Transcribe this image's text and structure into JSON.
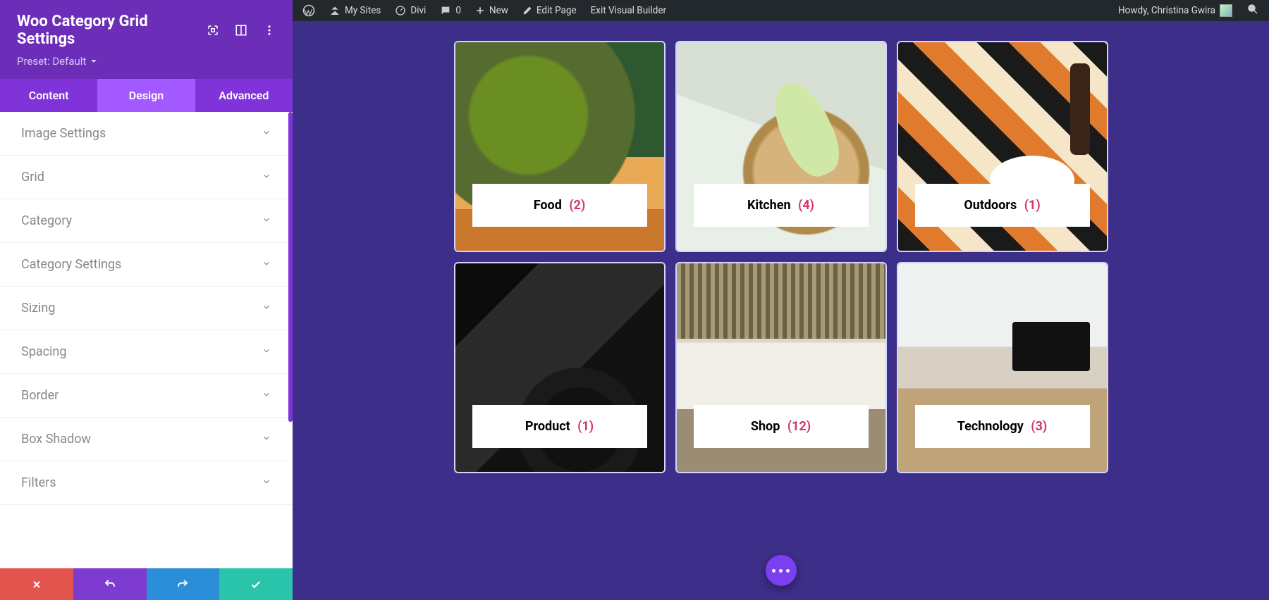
{
  "panel": {
    "title": "Woo Category Grid Settings",
    "preset": "Preset: Default",
    "tabs": {
      "content": "Content",
      "design": "Design",
      "advanced": "Advanced",
      "active": "design"
    },
    "sections": [
      "Image Settings",
      "Grid",
      "Category",
      "Category Settings",
      "Sizing",
      "Spacing",
      "Border",
      "Box Shadow",
      "Filters"
    ]
  },
  "adminbar": {
    "mysites": "My Sites",
    "site": "Divi",
    "comments": "0",
    "new": "New",
    "edit": "Edit Page",
    "exit": "Exit Visual Builder",
    "greeting": "Howdy, Christina Gwira"
  },
  "cards": [
    {
      "title": "Food",
      "count": "(2)",
      "img": "img-food"
    },
    {
      "title": "Kitchen",
      "count": "(4)",
      "img": "img-kitchen"
    },
    {
      "title": "Outdoors",
      "count": "(1)",
      "img": "img-outdoors"
    },
    {
      "title": "Product",
      "count": "(1)",
      "img": "img-product"
    },
    {
      "title": "Shop",
      "count": "(12)",
      "img": "img-shop"
    },
    {
      "title": "Technology",
      "count": "(3)",
      "img": "img-tech"
    }
  ]
}
